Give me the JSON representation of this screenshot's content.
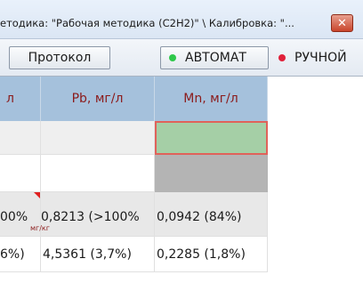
{
  "window": {
    "title": "етодика: \"Рабочая методика  (C2H2)\" \\  Калибровка: \"...",
    "close_glyph": "✕"
  },
  "toolbar": {
    "protocol_label": "Протокол",
    "auto_label": "АВТОМАТ",
    "manual_label": "РУЧНОЙ",
    "auto_indicator_color": "#2ec84a",
    "manual_indicator_color": "#e0203a"
  },
  "table": {
    "headers": [
      "л",
      "Pb, мг/л",
      "Mn, мг/л"
    ],
    "rows": [
      {
        "cells": [
          "",
          "",
          ""
        ],
        "status": [
          "normal",
          "normal",
          "selected-green"
        ]
      },
      {
        "cells": [
          "",
          "",
          ""
        ],
        "status": [
          "normal",
          "normal",
          "gray"
        ]
      },
      {
        "cells": [
          "00%",
          "0,8213 (>100%",
          "0,0942 (84%)"
        ],
        "sub_unit": "мг/кг"
      },
      {
        "cells": [
          "6%)",
          "4,5361 (3,7%)",
          "0,2285 (1,8%)"
        ]
      }
    ]
  }
}
